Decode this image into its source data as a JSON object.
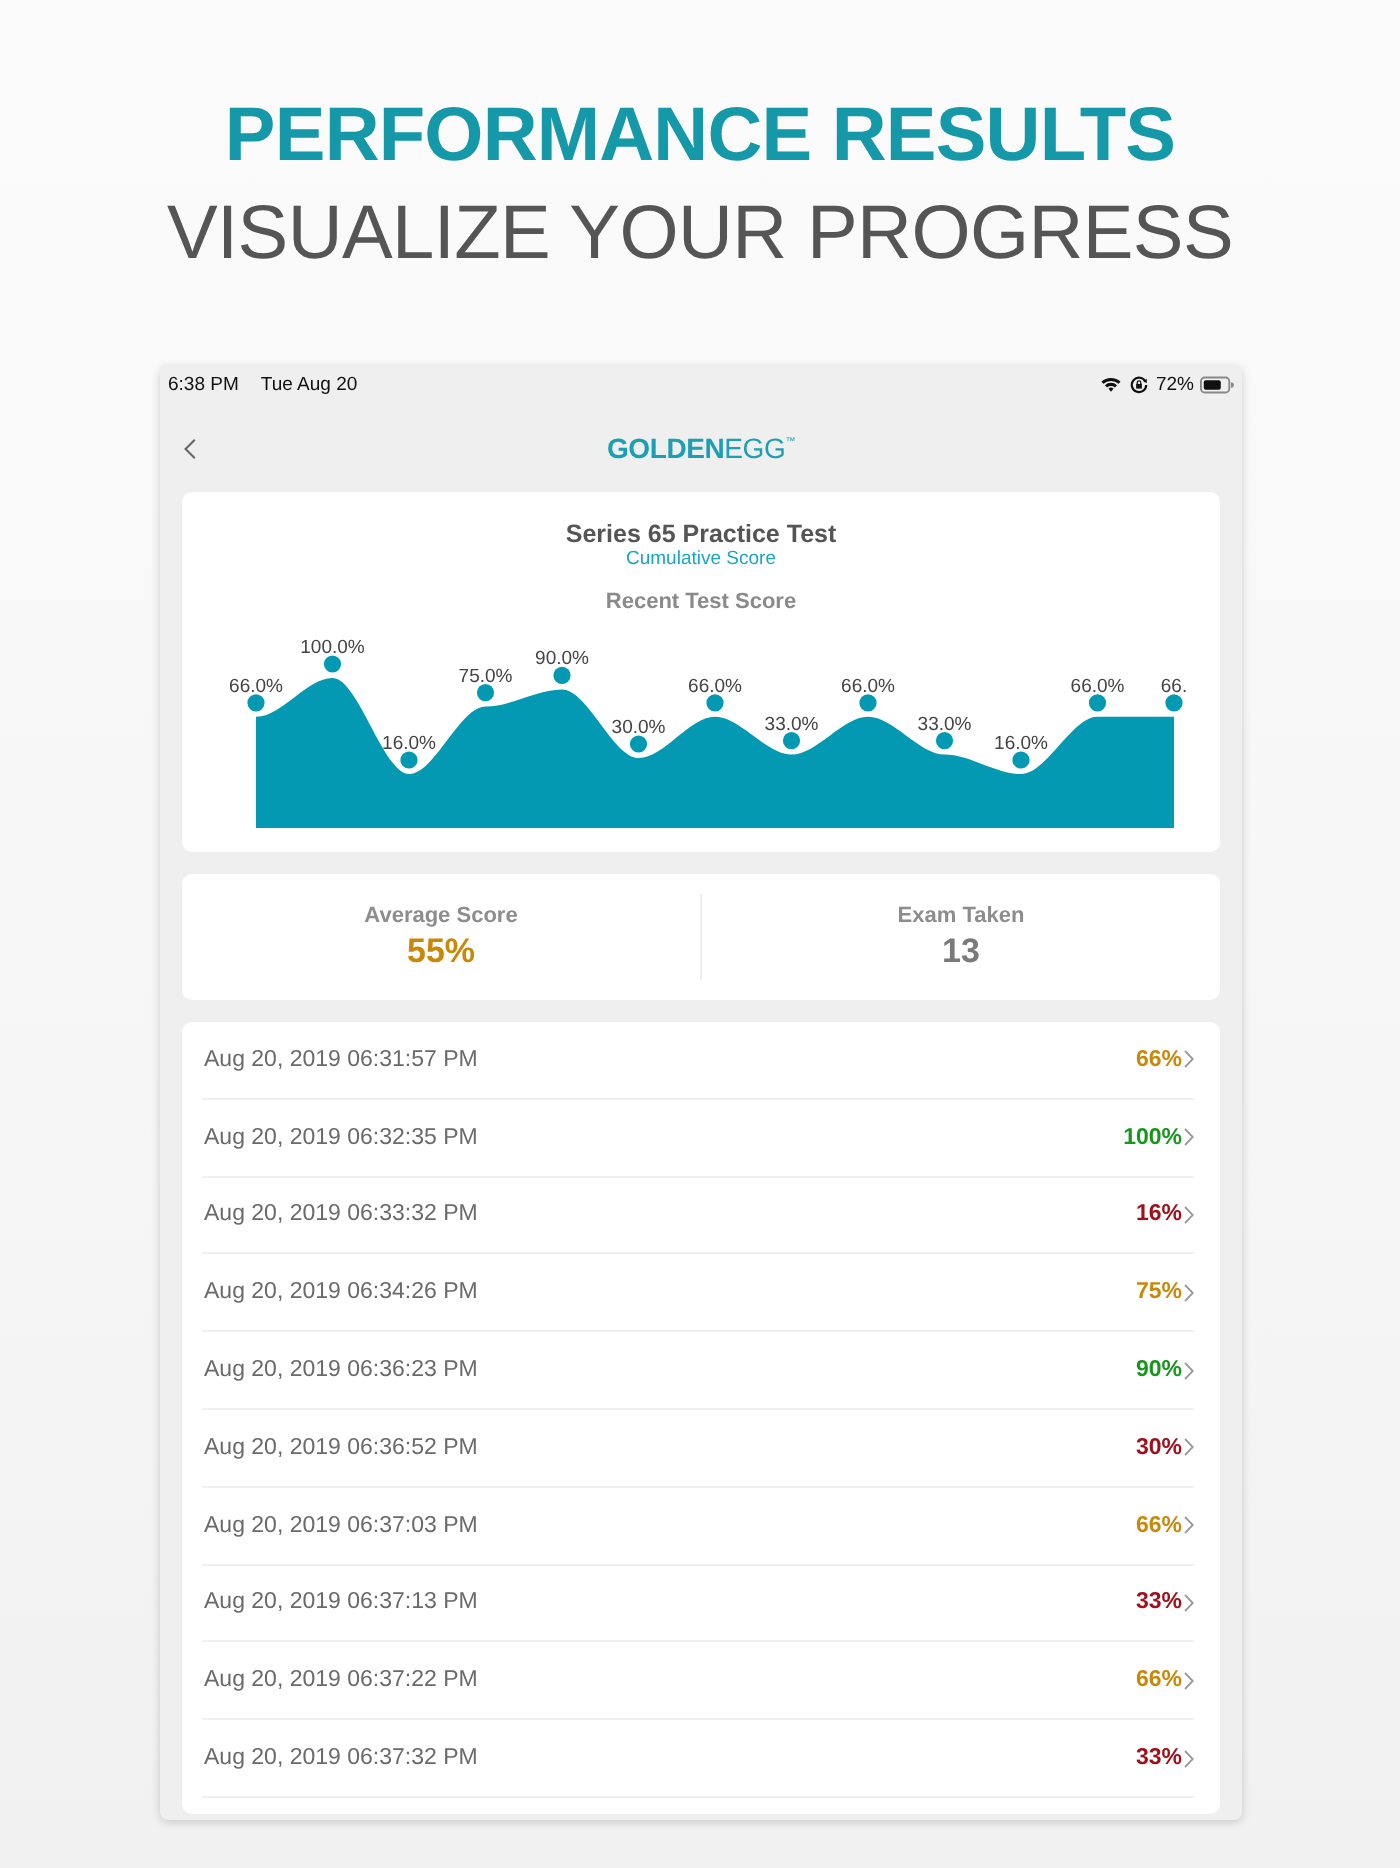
{
  "heading": {
    "title": "PERFORMANCE RESULTS",
    "subtitle": "VISUALIZE YOUR PROGRESS"
  },
  "status_bar": {
    "time": "6:38 PM",
    "date": "Tue Aug 20",
    "battery_text": "72%"
  },
  "nav_bar": {
    "logo": "**GOLDEN**EGG$^{™}$"
  },
  "chart_card": {
    "title": "Series 65 Practice Test",
    "subtitle": "Cumulative Score",
    "chart_title": "Recent Test Score",
    "point_labels": [
      "66.0%",
      "100.0%",
      "16.0%",
      "75.0%",
      "90.0%",
      "30.0%",
      "66.0%",
      "33.0%",
      "66.0%",
      "33.0%",
      "16.0%",
      "66.0%",
      "66."
    ]
  },
  "stats": [
    {
      "label": "Average Score",
      "value": "55%",
      "color": "#c8890a"
    },
    {
      "label": "Exam Taken",
      "value": "13",
      "color": "#7a7a7a"
    }
  ],
  "results": [
    {
      "date": "Aug 20, 2019 06:31:57 PM",
      "score": "66%",
      "color": "#c8890a"
    },
    {
      "date": "Aug 20, 2019 06:32:35 PM",
      "score": "100%",
      "color": "#16961a"
    },
    {
      "date": "Aug 20, 2019 06:33:32 PM",
      "score": "16%",
      "color": "#a0101a"
    },
    {
      "date": "Aug 20, 2019 06:34:26 PM",
      "score": "75%",
      "color": "#c8890a"
    },
    {
      "date": "Aug 20, 2019 06:36:23 PM",
      "score": "90%",
      "color": "#16961a"
    },
    {
      "date": "Aug 20, 2019 06:36:52 PM",
      "score": "30%",
      "color": "#a0101a"
    },
    {
      "date": "Aug 20, 2019 06:37:03 PM",
      "score": "66%",
      "color": "#c8890a"
    },
    {
      "date": "Aug 20, 2019 06:37:13 PM",
      "score": "33%",
      "color": "#a0101a"
    },
    {
      "date": "Aug 20, 2019 06:37:22 PM",
      "score": "66%",
      "color": "#c8890a"
    },
    {
      "date": "Aug 20, 2019 06:37:32 PM",
      "score": "33%",
      "color": "#a0101a"
    }
  ]
}
